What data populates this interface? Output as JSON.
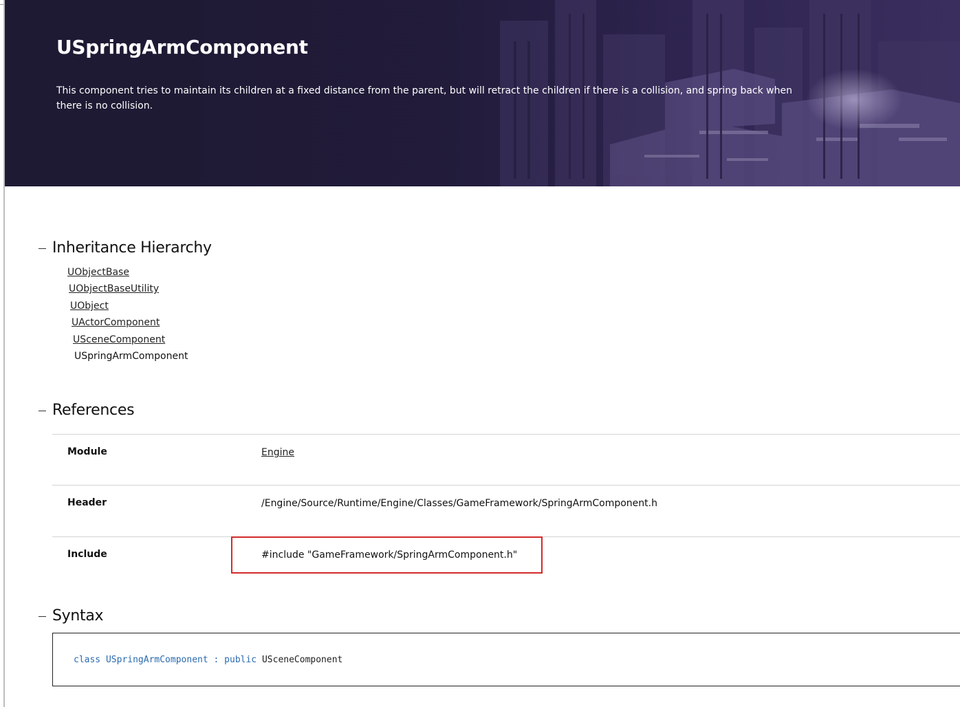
{
  "hero": {
    "title": "USpringArmComponent",
    "description": "This component tries to maintain its children at a fixed distance from the parent, but will retract the children if there is a collision, and spring back when there is no collision."
  },
  "inheritance": {
    "heading": "Inheritance Hierarchy",
    "items": [
      {
        "label": "UObjectBase",
        "link": true
      },
      {
        "label": "UObjectBaseUtility",
        "link": true
      },
      {
        "label": "UObject",
        "link": true
      },
      {
        "label": "UActorComponent",
        "link": true
      },
      {
        "label": "USceneComponent",
        "link": true
      },
      {
        "label": "USpringArmComponent",
        "link": false
      }
    ]
  },
  "references": {
    "heading": "References",
    "rows": [
      {
        "label": "Module",
        "value": "Engine",
        "link": true
      },
      {
        "label": "Header",
        "value": "/Engine/Source/Runtime/Engine/Classes/GameFramework/SpringArmComponent.h",
        "link": false
      },
      {
        "label": "Include",
        "value": "#include \"GameFramework/SpringArmComponent.h\"",
        "link": false,
        "highlighted": true
      }
    ]
  },
  "syntax": {
    "heading": "Syntax",
    "keyword_class": "class",
    "class_name": "USpringArmComponent",
    "separator": ":",
    "keyword_public": "public",
    "base_class": "USceneComponent"
  },
  "colors": {
    "hero_bg": "#231c3d",
    "code_keyword": "#2a6bb0",
    "highlight_border": "#d22b2b"
  }
}
